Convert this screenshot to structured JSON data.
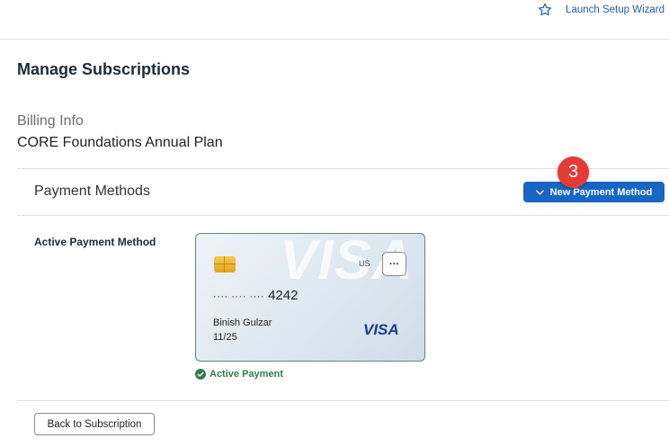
{
  "header": {
    "wizard_link": {
      "label": "Launch Setup Wizard",
      "icon": "star-icon"
    }
  },
  "page": {
    "title": "Manage Subscriptions"
  },
  "billing": {
    "label": "Billing Info",
    "plan": "CORE Foundations Annual Plan"
  },
  "payment_methods": {
    "title": "Payment Methods",
    "new_button_label": "New Payment Method",
    "step_badge": "3"
  },
  "active_method": {
    "label": "Active Payment Method",
    "card": {
      "watermark": "VISA",
      "country": "US",
      "more_label": "···",
      "masked": "···· ···· ····",
      "last4": "4242",
      "holder": "Binish Gulzar",
      "expiry": "11/25",
      "brand": "VISA"
    },
    "status": "Active Payment"
  },
  "footer": {
    "back_button_label": "Back to Subscription"
  },
  "colors": {
    "primary": "#1766c5",
    "badge": "#e53b36",
    "success": "#2e7d4e",
    "card_border": "#5c8a6e"
  }
}
